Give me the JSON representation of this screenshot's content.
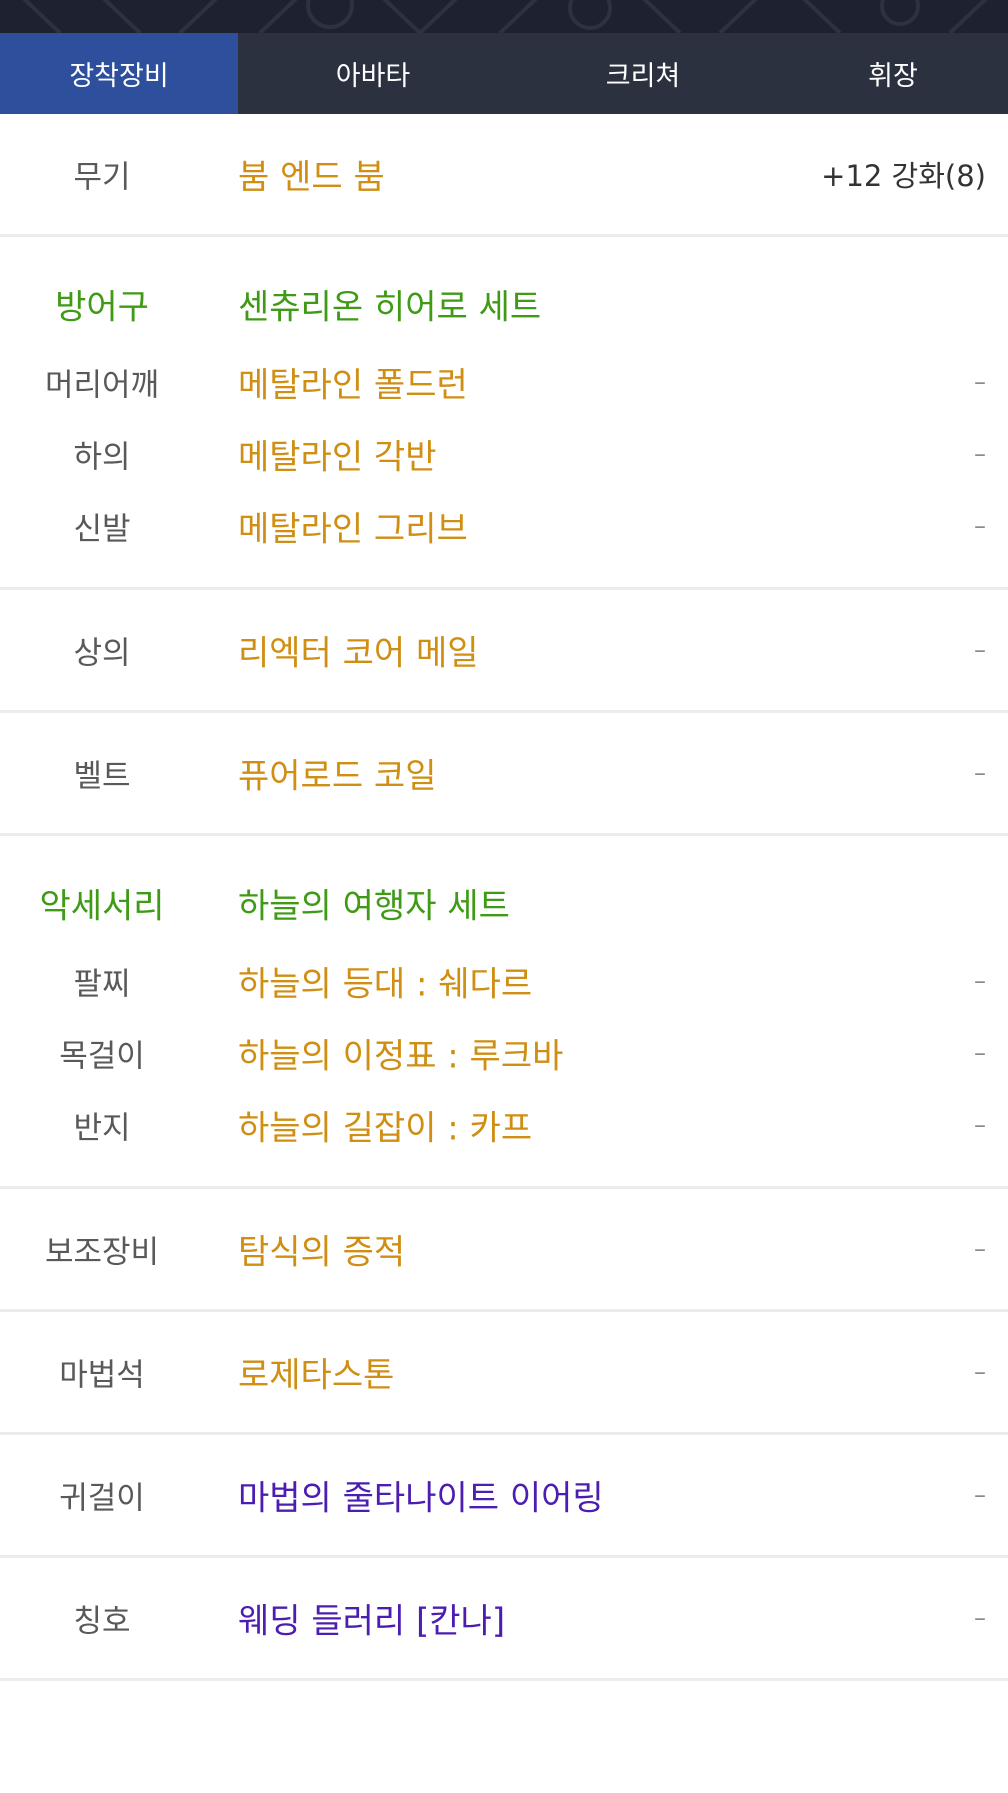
{
  "tabs": [
    {
      "label": "장착장비",
      "active": true
    },
    {
      "label": "아바타",
      "active": false
    },
    {
      "label": "크리쳐",
      "active": false
    },
    {
      "label": "휘장",
      "active": false
    }
  ],
  "weapon": {
    "label": "무기",
    "name": "붐 엔드 붐",
    "enhance": "+12 강화(8)"
  },
  "armor": {
    "category": "방어구",
    "set_name": "센츄리온 히어로 세트",
    "items": [
      {
        "label": "머리어깨",
        "name": "메탈라인 폴드런",
        "extra": "–"
      },
      {
        "label": "하의",
        "name": "메탈라인 각반",
        "extra": "–"
      },
      {
        "label": "신발",
        "name": "메탈라인 그리브",
        "extra": "–"
      }
    ]
  },
  "top": {
    "label": "상의",
    "name": "리엑터 코어 메일",
    "extra": "–"
  },
  "belt": {
    "label": "벨트",
    "name": "퓨어로드 코일",
    "extra": "–"
  },
  "accessory": {
    "category": "악세서리",
    "set_name": "하늘의 여행자 세트",
    "items": [
      {
        "label": "팔찌",
        "name": "하늘의 등대 : 쉐다르",
        "extra": "–"
      },
      {
        "label": "목걸이",
        "name": "하늘의 이정표 : 루크바",
        "extra": "–"
      },
      {
        "label": "반지",
        "name": "하늘의 길잡이 : 카프",
        "extra": "–"
      }
    ]
  },
  "sub_equipment": {
    "label": "보조장비",
    "name": "탐식의 증적",
    "extra": "–"
  },
  "magic_stone": {
    "label": "마법석",
    "name": "로제타스톤",
    "extra": "–"
  },
  "earring": {
    "label": "귀걸이",
    "name": "마법의 줄타나이트 이어링",
    "extra": "–"
  },
  "title": {
    "label": "칭호",
    "name": "웨딩 들러리 [칸나]",
    "extra": "–"
  },
  "colors": {
    "tab_bar": "#2b313e",
    "tab_active": "#2d4f9c",
    "rare_gold": "#d08e13",
    "set_green": "#3f9a15",
    "unique_purple": "#4b1db0"
  }
}
